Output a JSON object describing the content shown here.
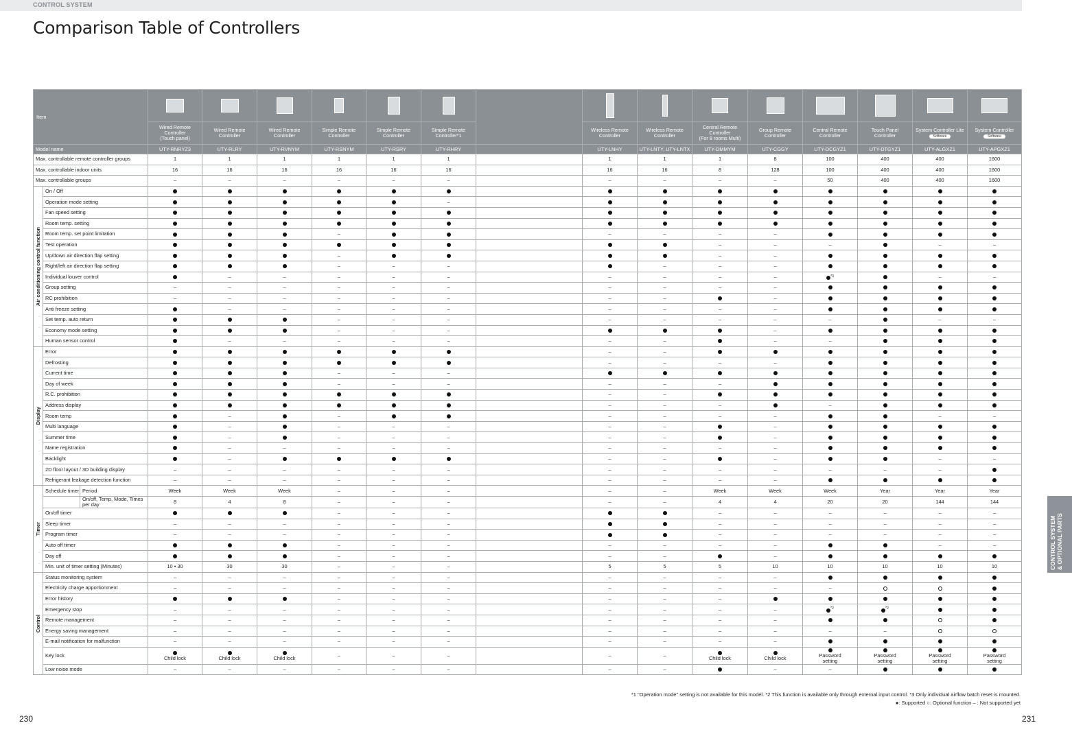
{
  "section_label": "CONTROL SYSTEM",
  "title": "Comparison Table of Controllers",
  "side_tab": [
    "CONTROL SYSTEM",
    "& OPTIONAL PARTS"
  ],
  "page_left": "230",
  "page_right": "231",
  "item_header": "Item",
  "controllers": [
    {
      "name": [
        "Wired Remote",
        "Controller",
        "(Touch panel)"
      ],
      "model": "UTY-RNRYZ3",
      "icon": "wired-touch-panel-controller-icon"
    },
    {
      "name": [
        "Wired Remote",
        "Controller"
      ],
      "model": "UTY-RLRY",
      "icon": "wired-remote-controller-icon"
    },
    {
      "name": [
        "Wired Remote",
        "Controller"
      ],
      "model": "UTY-RVNYM",
      "icon": "wired-remote-controller-icon"
    },
    {
      "name": [
        "Simple Remote",
        "Controller"
      ],
      "model": "UTY-RSNYM",
      "icon": "simple-remote-controller-icon"
    },
    {
      "name": [
        "Simple Remote",
        "Controller"
      ],
      "model": "UTY-RSRY",
      "icon": "simple-remote-controller-icon"
    },
    {
      "name": [
        "Simple Remote",
        "Controller*1"
      ],
      "model": "UTY-RHRY",
      "icon": "simple-remote-controller-icon"
    },
    {
      "name": [
        "Wireless Remote",
        "Controller"
      ],
      "model": "UTY-LNHY",
      "icon": "wireless-remote-controller-icon"
    },
    {
      "name": [
        "Wireless Remote",
        "Controller"
      ],
      "model": "UTY-LNTY, UTY-LNTX",
      "icon": "wireless-remote-controller-icon"
    },
    {
      "name": [
        "Central Remote",
        "Controller",
        "(For 8 rooms Multi)"
      ],
      "model": "UTY-DMMYM",
      "icon": "central-remote-controller-icon"
    },
    {
      "name": [
        "Group Remote",
        "Controller"
      ],
      "model": "UTY-CGGY",
      "icon": "group-remote-controller-icon"
    },
    {
      "name": [
        "Central Remote",
        "Controller"
      ],
      "model": "UTY-DCGYZ1",
      "icon": "central-remote-controller-icon"
    },
    {
      "name": [
        "Touch Panel",
        "Controller"
      ],
      "model": "UTY-DTGYZ1",
      "icon": "touch-panel-controller-icon"
    },
    {
      "name": [
        "System Controller Lite"
      ],
      "badge": "Software",
      "model": "UTY-ALGXZ1",
      "icon": "pc-monitor-icon"
    },
    {
      "name": [
        "System Controller"
      ],
      "badge": "Software",
      "model": "UTY-APGXZ1",
      "icon": "pc-monitor-icon"
    }
  ],
  "model_label": "Model name",
  "general_rows": [
    {
      "label": "Max. controllable remote controller groups",
      "cells": [
        "1",
        "1",
        "1",
        "1",
        "1",
        "1",
        "1",
        "1",
        "1",
        "8",
        "100",
        "400",
        "400",
        "1600"
      ]
    },
    {
      "label": "Max. controllable indoor units",
      "cells": [
        "16",
        "16",
        "16",
        "16",
        "16",
        "16",
        "16",
        "16",
        "8",
        "128",
        "100",
        "400",
        "400",
        "1600"
      ]
    },
    {
      "label": "Max. controllable groups",
      "cells": [
        "–",
        "–",
        "–",
        "–",
        "–",
        "–",
        "–",
        "–",
        "–",
        "–",
        "50",
        "400",
        "400",
        "1600"
      ]
    }
  ],
  "groups": [
    {
      "label": "Air conditioning control function",
      "rows": [
        {
          "label": "On / Off",
          "cells": [
            "●",
            "●",
            "●",
            "●",
            "●",
            "●",
            "●",
            "●",
            "●",
            "●",
            "●",
            "●",
            "●",
            "●"
          ]
        },
        {
          "label": "Operation mode setting",
          "cells": [
            "●",
            "●",
            "●",
            "●",
            "●",
            "–",
            "●",
            "●",
            "●",
            "●",
            "●",
            "●",
            "●",
            "●"
          ]
        },
        {
          "label": "Fan speed setting",
          "cells": [
            "●",
            "●",
            "●",
            "●",
            "●",
            "●",
            "●",
            "●",
            "●",
            "●",
            "●",
            "●",
            "●",
            "●"
          ]
        },
        {
          "label": "Room temp. setting",
          "cells": [
            "●",
            "●",
            "●",
            "●",
            "●",
            "●",
            "●",
            "●",
            "●",
            "●",
            "●",
            "●",
            "●",
            "●"
          ]
        },
        {
          "label": "Room temp. set point limitation",
          "cells": [
            "●",
            "●",
            "●",
            "–",
            "●",
            "●",
            "–",
            "–",
            "–",
            "–",
            "●",
            "●",
            "●",
            "●"
          ]
        },
        {
          "label": "Test operation",
          "cells": [
            "●",
            "●",
            "●",
            "●",
            "●",
            "●",
            "●",
            "●",
            "–",
            "–",
            "–",
            "●",
            "–",
            "–"
          ]
        },
        {
          "label": "Up/down air direction flap setting",
          "cells": [
            "●",
            "●",
            "●",
            "–",
            "●",
            "●",
            "●",
            "●",
            "–",
            "–",
            "●",
            "●",
            "●",
            "●"
          ]
        },
        {
          "label": "Right/left air direction flap setting",
          "cells": [
            "●",
            "●",
            "●",
            "–",
            "–",
            "–",
            "●",
            "–",
            "–",
            "–",
            "●",
            "●",
            "●",
            "●"
          ]
        },
        {
          "label": "Individual louver control",
          "cells": [
            "●",
            "–",
            "–",
            "–",
            "–",
            "–",
            "–",
            "–",
            "–",
            "–",
            "●*3",
            "●",
            "–",
            "–"
          ]
        },
        {
          "label": "Group setting",
          "cells": [
            "–",
            "–",
            "–",
            "–",
            "–",
            "–",
            "–",
            "–",
            "–",
            "–",
            "●",
            "●",
            "●",
            "●"
          ]
        },
        {
          "label": "RC prohibition",
          "cells": [
            "–",
            "–",
            "–",
            "–",
            "–",
            "–",
            "–",
            "–",
            "●",
            "–",
            "●",
            "●",
            "●",
            "●"
          ]
        },
        {
          "label": "Anti freeze setting",
          "cells": [
            "●",
            "–",
            "–",
            "–",
            "–",
            "–",
            "–",
            "–",
            "–",
            "–",
            "●",
            "●",
            "●",
            "●"
          ]
        },
        {
          "label": "Set temp. auto return",
          "cells": [
            "●",
            "●",
            "●",
            "–",
            "–",
            "–",
            "–",
            "–",
            "–",
            "–",
            "–",
            "●",
            "–",
            "–"
          ]
        },
        {
          "label": "Economy mode setting",
          "cells": [
            "●",
            "●",
            "●",
            "–",
            "–",
            "–",
            "●",
            "●",
            "●",
            "–",
            "●",
            "●",
            "●",
            "●"
          ]
        },
        {
          "label": "Human sensor control",
          "cells": [
            "●",
            "–",
            "–",
            "–",
            "–",
            "–",
            "–",
            "–",
            "●",
            "–",
            "–",
            "●",
            "●",
            "●"
          ]
        }
      ]
    },
    {
      "label": "Display",
      "rows": [
        {
          "label": "Error",
          "cells": [
            "●",
            "●",
            "●",
            "●",
            "●",
            "●",
            "–",
            "–",
            "●",
            "●",
            "●",
            "●",
            "●",
            "●"
          ]
        },
        {
          "label": "Defrosting",
          "cells": [
            "●",
            "●",
            "●",
            "●",
            "●",
            "●",
            "–",
            "–",
            "–",
            "–",
            "●",
            "●",
            "●",
            "●"
          ]
        },
        {
          "label": "Current time",
          "cells": [
            "●",
            "●",
            "●",
            "–",
            "–",
            "–",
            "●",
            "●",
            "●",
            "●",
            "●",
            "●",
            "●",
            "●"
          ]
        },
        {
          "label": "Day of week",
          "cells": [
            "●",
            "●",
            "●",
            "–",
            "–",
            "–",
            "–",
            "–",
            "–",
            "●",
            "●",
            "●",
            "●",
            "●"
          ]
        },
        {
          "label": "R.C. prohibition",
          "cells": [
            "●",
            "●",
            "●",
            "●",
            "●",
            "●",
            "–",
            "–",
            "●",
            "●",
            "●",
            "●",
            "●",
            "●"
          ]
        },
        {
          "label": "Address display",
          "cells": [
            "●",
            "●",
            "●",
            "●",
            "●",
            "●",
            "–",
            "–",
            "–",
            "●",
            "–",
            "●",
            "●",
            "●"
          ]
        },
        {
          "label": "Room temp",
          "cells": [
            "●",
            "–",
            "●",
            "–",
            "●",
            "●",
            "–",
            "–",
            "–",
            "–",
            "●",
            "●",
            "–",
            "–"
          ]
        },
        {
          "label": "Multi language",
          "cells": [
            "●",
            "–",
            "●",
            "–",
            "–",
            "–",
            "–",
            "–",
            "●",
            "–",
            "●",
            "●",
            "●",
            "●"
          ]
        },
        {
          "label": "Summer time",
          "cells": [
            "●",
            "–",
            "●",
            "–",
            "–",
            "–",
            "–",
            "–",
            "●",
            "–",
            "●",
            "●",
            "●",
            "●"
          ]
        },
        {
          "label": "Name registration",
          "cells": [
            "●",
            "–",
            "–",
            "–",
            "–",
            "–",
            "–",
            "–",
            "–",
            "–",
            "●",
            "●",
            "●",
            "●"
          ]
        },
        {
          "label": "Backlight",
          "cells": [
            "●",
            "–",
            "●",
            "●",
            "●",
            "●",
            "–",
            "–",
            "●",
            "–",
            "●",
            "●",
            "–",
            "–"
          ]
        },
        {
          "label": "2D floor layout / 3D building display",
          "cells": [
            "–",
            "–",
            "–",
            "–",
            "–",
            "–",
            "–",
            "–",
            "–",
            "–",
            "–",
            "–",
            "–",
            "●"
          ]
        },
        {
          "label": "Refrigerant leakage detection function",
          "cells": [
            "–",
            "–",
            "–",
            "–",
            "–",
            "–",
            "–",
            "–",
            "–",
            "–",
            "●",
            "●",
            "●",
            "●"
          ]
        }
      ]
    },
    {
      "label": "Timer",
      "schedule_label": "Schedule timer",
      "schedule_rows": [
        {
          "label": "Period",
          "cells": [
            "Week",
            "Week",
            "Week",
            "–",
            "–",
            "–",
            "–",
            "–",
            "Week",
            "Week",
            "Week",
            "Year",
            "Year",
            "Year"
          ]
        },
        {
          "label": "On/off, Temp, Mode, Times per day",
          "cells": [
            "8",
            "4",
            "8",
            "–",
            "–",
            "–",
            "–",
            "–",
            "4",
            "4",
            "20",
            "20",
            "144",
            "144"
          ]
        }
      ],
      "rows": [
        {
          "label": "On/off timer",
          "cells": [
            "●",
            "●",
            "●",
            "–",
            "–",
            "–",
            "●",
            "●",
            "–",
            "–",
            "–",
            "–",
            "–",
            "–"
          ]
        },
        {
          "label": "Sleep timer",
          "cells": [
            "–",
            "–",
            "–",
            "–",
            "–",
            "–",
            "●",
            "●",
            "–",
            "–",
            "–",
            "–",
            "–",
            "–"
          ]
        },
        {
          "label": "Program timer",
          "cells": [
            "–",
            "–",
            "–",
            "–",
            "–",
            "–",
            "●",
            "●",
            "–",
            "–",
            "–",
            "–",
            "–",
            "–"
          ]
        },
        {
          "label": "Auto off timer",
          "cells": [
            "●",
            "●",
            "●",
            "–",
            "–",
            "–",
            "–",
            "–",
            "–",
            "–",
            "●",
            "●",
            "–",
            "–"
          ]
        },
        {
          "label": "Day off",
          "cells": [
            "●",
            "●",
            "●",
            "–",
            "–",
            "–",
            "–",
            "–",
            "●",
            "–",
            "●",
            "●",
            "●",
            "●"
          ]
        },
        {
          "label": "Min. unit of timer setting (Minutes)",
          "cells": [
            "10 • 30",
            "30",
            "30",
            "–",
            "–",
            "–",
            "5",
            "5",
            "5",
            "10",
            "10",
            "10",
            "10",
            "10"
          ]
        }
      ]
    },
    {
      "label": "Control",
      "rows": [
        {
          "label": "Status monitoring system",
          "cells": [
            "–",
            "–",
            "–",
            "–",
            "–",
            "–",
            "–",
            "–",
            "–",
            "–",
            "●",
            "●",
            "●",
            "●"
          ]
        },
        {
          "label": "Electricity charge apportionment",
          "cells": [
            "–",
            "–",
            "–",
            "–",
            "–",
            "–",
            "–",
            "–",
            "–",
            "–",
            "–",
            "○",
            "○",
            "●"
          ]
        },
        {
          "label": "Error history",
          "cells": [
            "●",
            "●",
            "●",
            "–",
            "–",
            "–",
            "–",
            "–",
            "–",
            "●",
            "●",
            "●",
            "●",
            "●"
          ]
        },
        {
          "label": "Emergency stop",
          "cells": [
            "–",
            "–",
            "–",
            "–",
            "–",
            "–",
            "–",
            "–",
            "–",
            "–",
            "●*2",
            "●*2",
            "●",
            "●"
          ]
        },
        {
          "label": "Remote management",
          "cells": [
            "–",
            "–",
            "–",
            "–",
            "–",
            "–",
            "–",
            "–",
            "–",
            "–",
            "●",
            "●",
            "○",
            "●"
          ]
        },
        {
          "label": "Energy saving management",
          "cells": [
            "–",
            "–",
            "–",
            "–",
            "–",
            "–",
            "–",
            "–",
            "–",
            "–",
            "–",
            "–",
            "○",
            "○"
          ]
        },
        {
          "label": "E-mail notification for malfunction",
          "cells": [
            "–",
            "–",
            "–",
            "–",
            "–",
            "–",
            "–",
            "–",
            "–",
            "–",
            "●",
            "●",
            "●",
            "●"
          ]
        }
      ],
      "keylock": {
        "label": "Key lock",
        "cells": [
          [
            "●",
            "Child lock"
          ],
          [
            "●",
            "Child lock"
          ],
          [
            "●",
            "Child lock"
          ],
          [
            "–"
          ],
          [
            "–"
          ],
          [
            "–"
          ],
          [
            "–"
          ],
          [
            "–"
          ],
          [
            "●",
            "Child lock"
          ],
          [
            "●",
            "Child lock"
          ],
          [
            "●",
            "Password",
            "setting"
          ],
          [
            "●",
            "Password",
            "setting"
          ],
          [
            "●",
            "Password",
            "setting"
          ],
          [
            "●",
            "Password",
            "setting"
          ]
        ]
      },
      "tail_rows": [
        {
          "label": "Low noise mode",
          "cells": [
            "–",
            "–",
            "–",
            "–",
            "–",
            "–",
            "–",
            "–",
            "●",
            "–",
            "–",
            "●",
            "●",
            "●"
          ]
        }
      ]
    }
  ],
  "footnote": "*1 \"Operation mode\" setting is not available for this model. *2 This function is available only through external input control. *3 Only individual airflow batch reset is mounted.",
  "legend": "●: Supported    ○: Optional function    – : Not supported yet"
}
